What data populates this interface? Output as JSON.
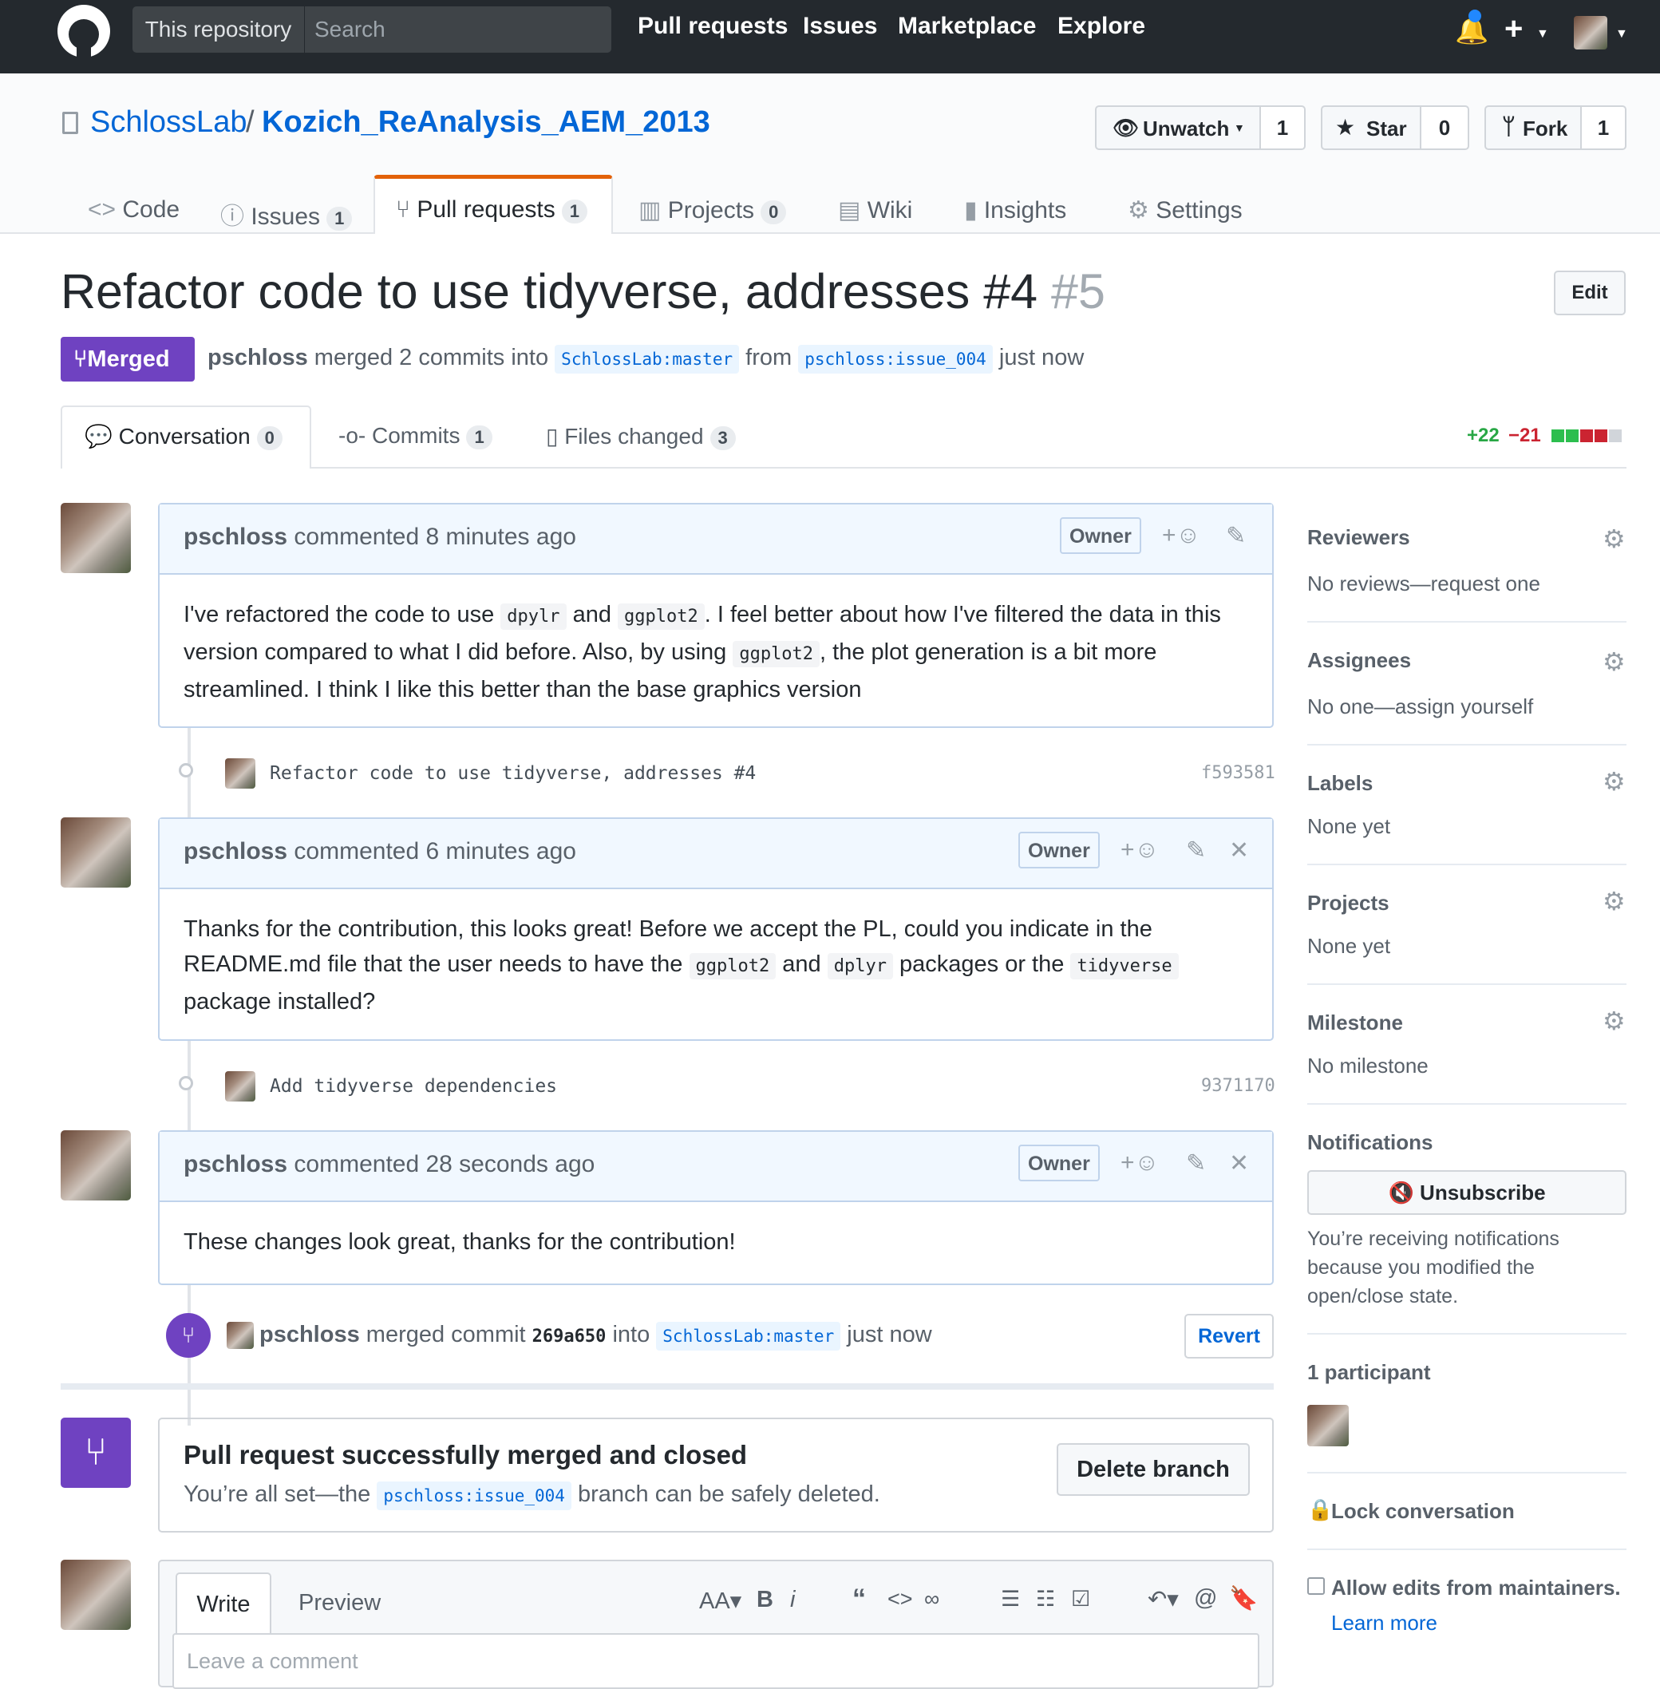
{
  "header": {
    "scope_label": "This repository",
    "search_placeholder": "Search",
    "nav": [
      "Pull requests",
      "Issues",
      "Marketplace",
      "Explore"
    ],
    "plus_label": "+"
  },
  "repo": {
    "owner": "SchlossLab",
    "separator": "/",
    "name": "Kozich_ReAnalysis_AEM_2013",
    "watch_label": "Unwatch",
    "watch_count": "1",
    "star_label": "Star",
    "star_count": "0",
    "fork_label": "Fork",
    "fork_count": "1",
    "tabs": [
      {
        "label": "Code",
        "icon": "<>"
      },
      {
        "label": "Issues",
        "count": "1"
      },
      {
        "label": "Pull requests",
        "count": "1"
      },
      {
        "label": "Projects",
        "count": "0"
      },
      {
        "label": "Wiki"
      },
      {
        "label": "Insights"
      },
      {
        "label": "Settings"
      }
    ]
  },
  "pr": {
    "title": "Refactor code to use tidyverse, addresses #4",
    "number": "#5",
    "edit_label": "Edit",
    "state": "Merged",
    "author": "pschloss",
    "merged_text": "merged 2 commits into",
    "base": "SchlossLab:master",
    "from_text": "from",
    "head": "pschloss:issue_004",
    "time": "just now",
    "tabs": [
      {
        "label": "Conversation",
        "count": "0"
      },
      {
        "label": "Commits",
        "count": "1"
      },
      {
        "label": "Files changed",
        "count": "3"
      }
    ],
    "additions": "+22",
    "deletions": "−21"
  },
  "comments": [
    {
      "author": "pschloss",
      "meta": "commented 8 minutes ago",
      "role": "Owner",
      "body_parts": [
        "I've refactored the code to use ",
        "dpylr",
        " and ",
        "ggplot2",
        ". I feel better about how I've filtered the data in this",
        "version compared to what I did before. Also, by using ",
        "ggplot2",
        ", the plot generation is a bit more",
        "streamlined. I think I like this better than the base graphics version"
      ]
    },
    {
      "author": "pschloss",
      "meta": "commented 6 minutes ago",
      "role": "Owner",
      "body_parts": [
        "Thanks for the contribution, this looks great! Before we accept the PL, could you indicate in the",
        "README.md file that the user needs to have the ",
        "ggplot2",
        " and ",
        "dplyr",
        " packages or the ",
        "tidyverse",
        "package installed?"
      ]
    },
    {
      "author": "pschloss",
      "meta": "commented 28 seconds ago",
      "role": "Owner",
      "body": "These changes look great, thanks for the contribution!"
    }
  ],
  "commits": [
    {
      "message": "Refactor code to use tidyverse, addresses #4",
      "sha": "f593581"
    },
    {
      "message": "Add tidyverse dependencies",
      "sha": "9371170"
    }
  ],
  "merge_event": {
    "author": "pschloss",
    "text": "merged commit",
    "sha": "269a650",
    "into": "into",
    "base": "SchlossLab:master",
    "time": "just now",
    "revert_label": "Revert"
  },
  "merged_box": {
    "title": "Pull request successfully merged and closed",
    "text_before": "You’re all set—the",
    "branch": "pschloss:issue_004",
    "text_after": "branch can be safely deleted.",
    "delete_label": "Delete branch"
  },
  "editor": {
    "write_tab": "Write",
    "preview_tab": "Preview",
    "placeholder": "Leave a comment"
  },
  "sidebar": {
    "reviewers": {
      "label": "Reviewers",
      "value": "No reviews—request one"
    },
    "assignees": {
      "label": "Assignees",
      "value": "No one—assign yourself"
    },
    "labels": {
      "label": "Labels",
      "value": "None yet"
    },
    "projects": {
      "label": "Projects",
      "value": "None yet"
    },
    "milestone": {
      "label": "Milestone",
      "value": "No milestone"
    },
    "notifications": {
      "label": "Notifications",
      "button": "Unsubscribe",
      "reason": [
        "You’re receiving notifications",
        "because you modified the",
        "open/close state."
      ]
    },
    "participants": "1 participant",
    "lock": "Lock conversation",
    "allow_edits": "Allow edits from maintainers.",
    "learn_more": "Learn more"
  },
  "colors": {
    "header_bg": "#24292e",
    "link": "#0366d6",
    "merged": "#6f42c1",
    "additions": "#28a745",
    "deletions": "#cb2431"
  }
}
